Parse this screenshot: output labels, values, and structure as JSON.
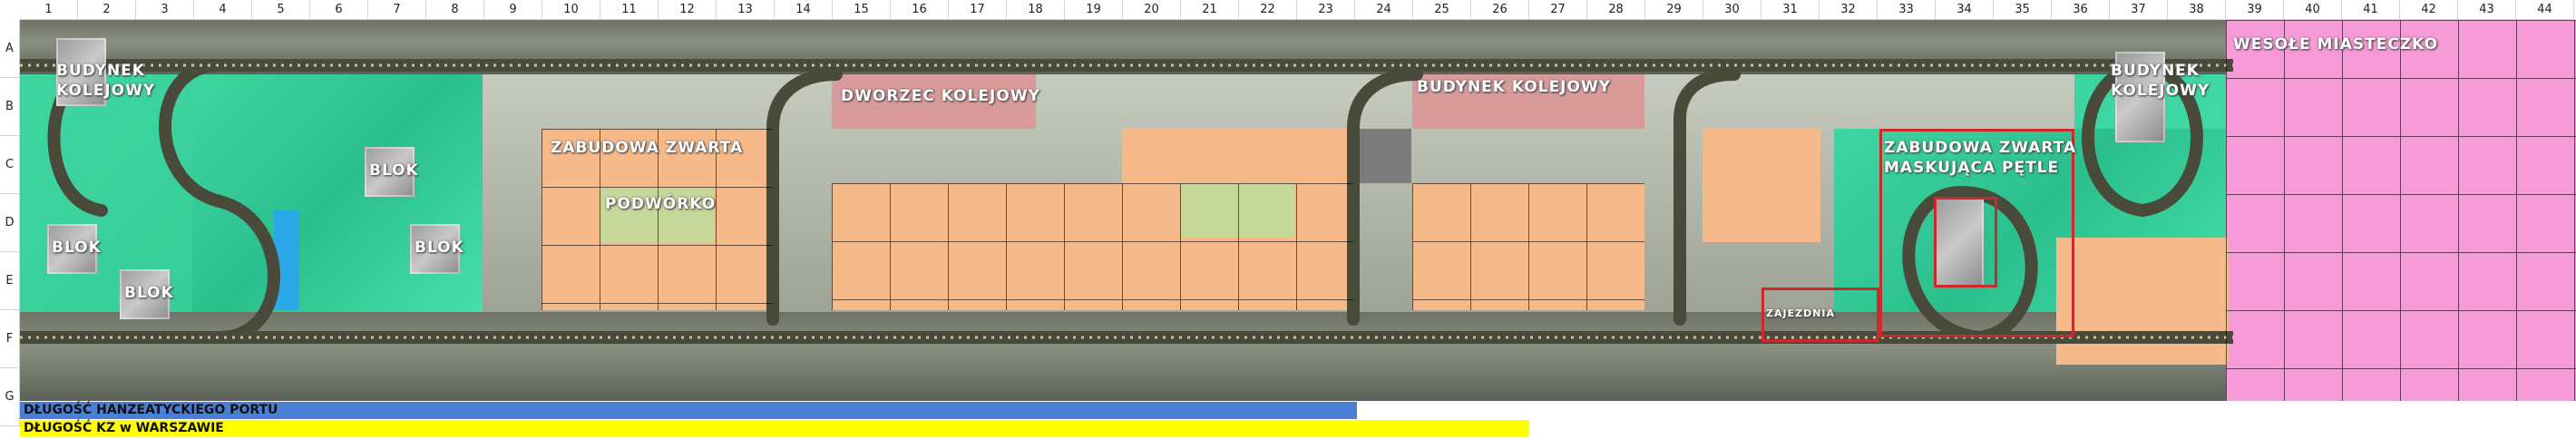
{
  "columns": [
    "1",
    "2",
    "3",
    "4",
    "5",
    "6",
    "7",
    "8",
    "9",
    "10",
    "11",
    "12",
    "13",
    "14",
    "15",
    "16",
    "17",
    "18",
    "19",
    "20",
    "21",
    "22",
    "23",
    "24",
    "25",
    "26",
    "27",
    "28",
    "29",
    "30",
    "31",
    "32",
    "33",
    "34",
    "35",
    "36",
    "37",
    "38",
    "39",
    "40",
    "41",
    "42",
    "43",
    "44"
  ],
  "rows": [
    "A",
    "B",
    "C",
    "D",
    "E",
    "F",
    "G"
  ],
  "labels": {
    "budynek_kolejowy_left": "BUDYNEK\nKOLEJOWY",
    "blok_1": "BLOK",
    "blok_2": "BLOK",
    "blok_3": "BLOK",
    "blok_4": "BLOK",
    "zabudowa_zwarta": "ZABUDOWA ZWARTA",
    "podworko": "PODWÓRKO",
    "dworzec_kolejowy": "DWORZEC KOLEJOWY",
    "budynek_kolejowy_mid": "BUDYNEK KOLEJOWY",
    "zabudowa_maskujaca": "ZABUDOWA ZWARTA\nMASKUJĄCA PĘTLE",
    "zajezdnia": "ZAJEZDNIA",
    "budynek_kolejowy_right": "BUDYNEK\nKOLEJOWY",
    "wesole_miasteczko": "WESOŁE MIASTECZKO"
  },
  "legend": {
    "port_length": "DŁUGOŚĆ HANZEATYCKIEGO PORTU",
    "kz_length": "DŁUGOŚĆ KZ w WARSZAWIE"
  },
  "colors": {
    "peach": "#f5b98a",
    "olive": "#c6d79a",
    "rose": "#d99a9a",
    "pink": "#f69ad8",
    "green": "#3fd6a2",
    "port_bar": "#4a7fd6",
    "kz_bar": "#ffff00",
    "red_outline": "#cc2a2a"
  }
}
